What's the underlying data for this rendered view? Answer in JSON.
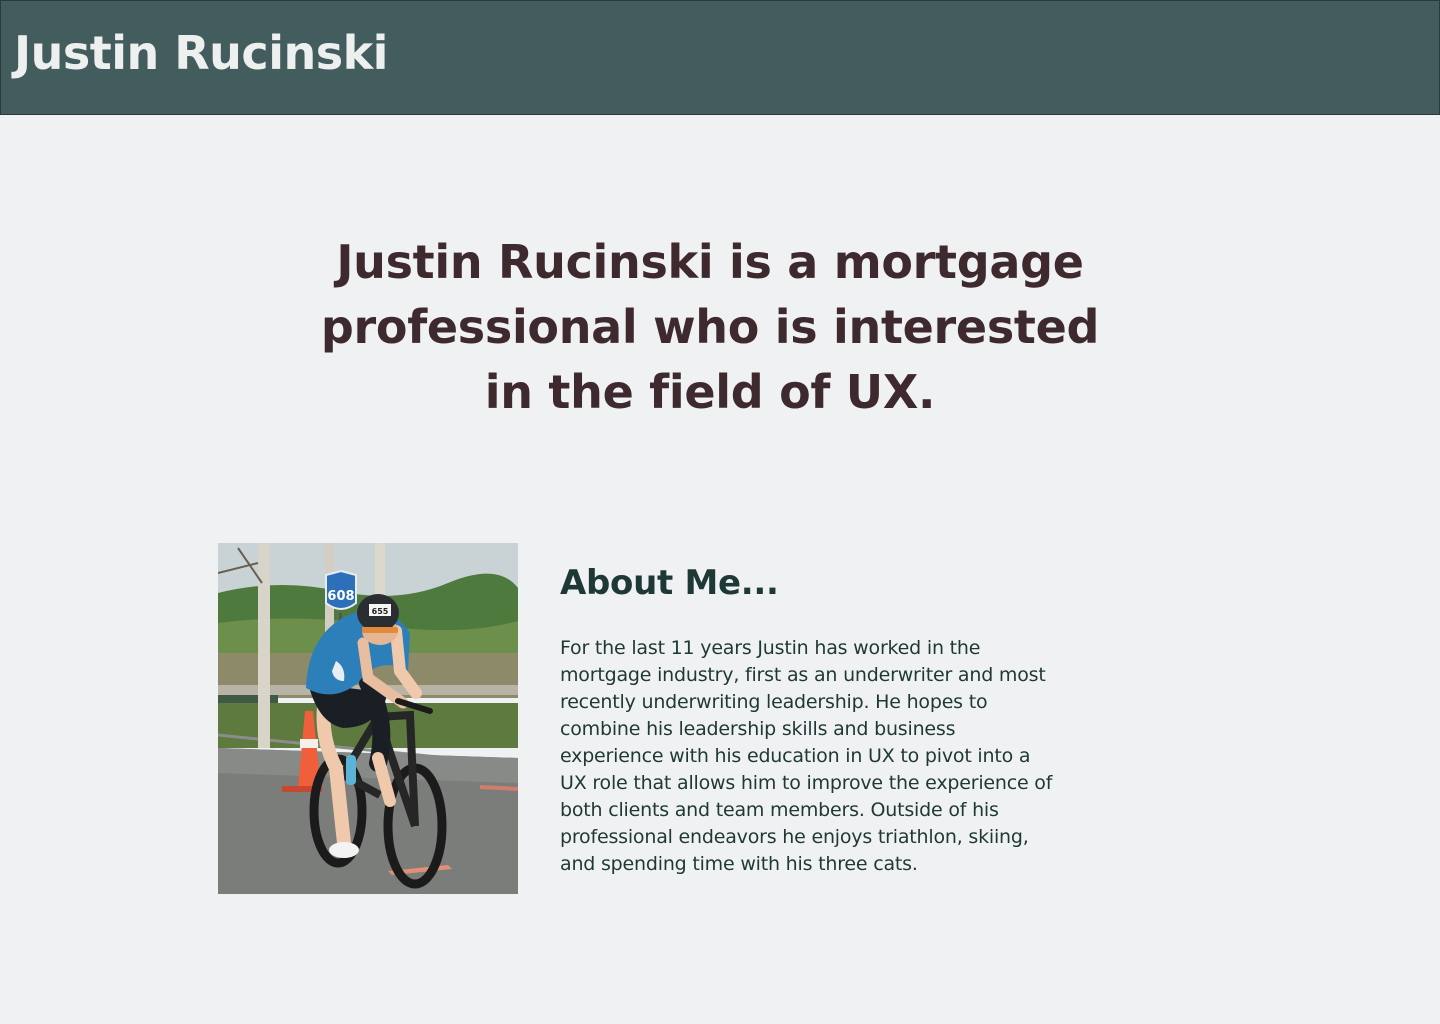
{
  "header": {
    "name": "Justin Rucinski"
  },
  "hero": {
    "headline": "Justin Rucinski is a mortgage professional who is interested in the field of UX."
  },
  "about": {
    "title": "About Me...",
    "body": "For the last 11 years Justin has worked in the mortgage industry, first as an underwriter and most recently underwriting leadership. He hopes to combine his leadership skills and business experience with his education in UX to pivot into a UX role that allows him to improve the experience of both clients and team members. Outside of his professional endeavors he enjoys triathlon, skiing, and spending time with his three cats.",
    "photo_sign_text": "608",
    "photo_bib_text": "655"
  },
  "colors": {
    "header_bg": "#435c5d",
    "header_text": "#eef0f0",
    "page_bg": "#f0f1f2",
    "headline": "#3e2a2e",
    "about_text": "#1e3836"
  }
}
